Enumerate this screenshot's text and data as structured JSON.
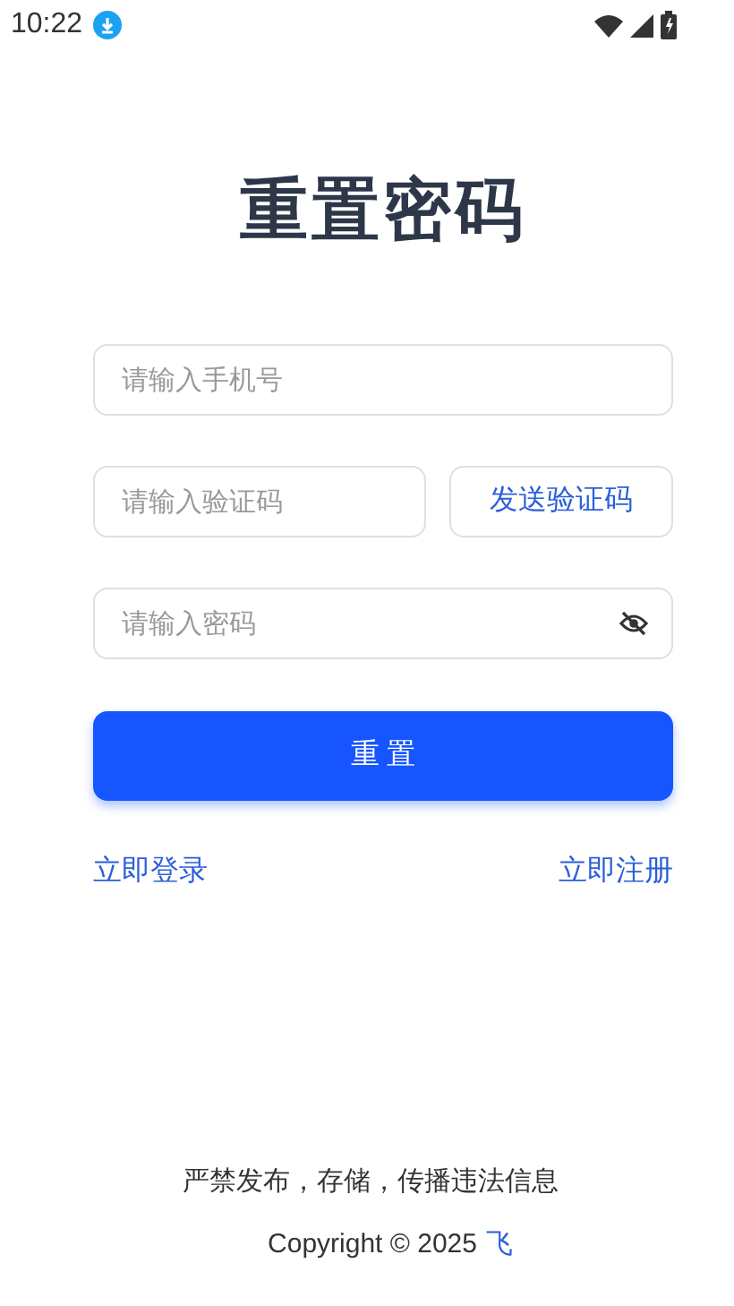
{
  "status_bar": {
    "time": "10:22"
  },
  "title": "重置密码",
  "phone_field": {
    "placeholder": "请输入手机号"
  },
  "code_field": {
    "placeholder": "请输入验证码"
  },
  "send_code_button": "发送验证码",
  "password_field": {
    "placeholder": "请输入密码",
    "visible": false
  },
  "reset_button": "重 置",
  "links": [
    "立即登录",
    "立即注册"
  ],
  "footer": {
    "notice": "严禁发布，存储，传播违法信息",
    "copyright": "Copyright © 2025",
    "company": "飞"
  }
}
